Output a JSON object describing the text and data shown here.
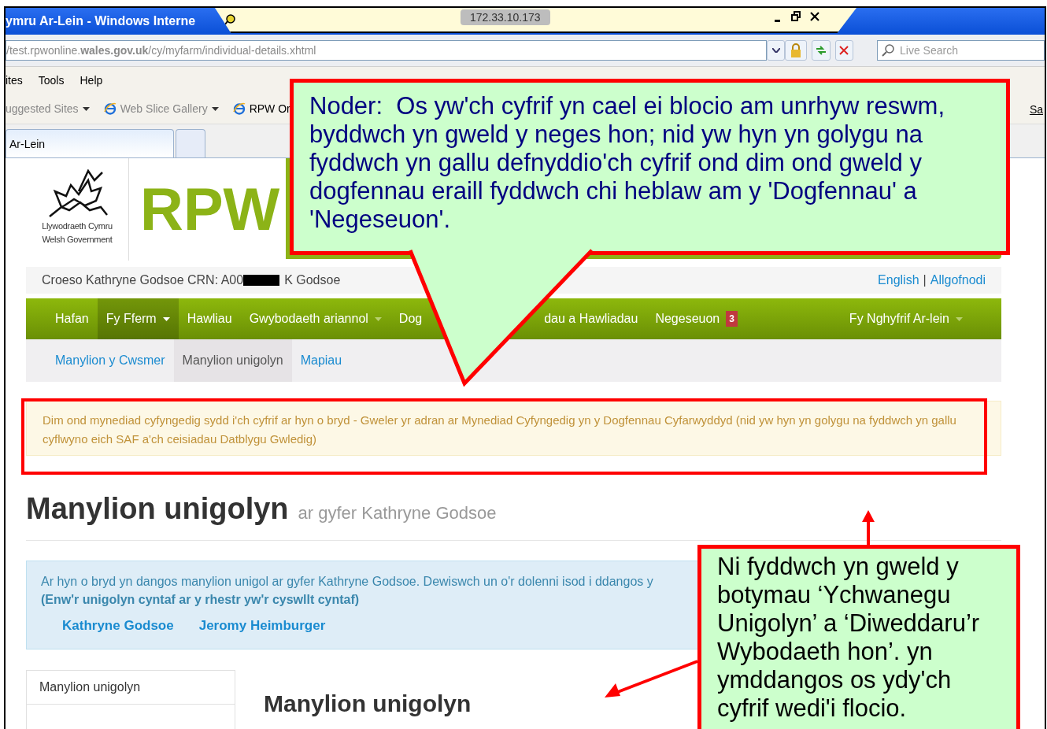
{
  "browser": {
    "title": "ymru Ar-Lein - Windows Interne",
    "ip": "172.33.10.173",
    "address": "/test.rpwonline.**wales.gov.uk**/cy/myfarm/individual-details.xhtml",
    "search_placeholder": "Live Search",
    "menu": [
      "ites",
      "Tools",
      "Help"
    ],
    "favorites": [
      {
        "label": "uggested Sites",
        "icon": false,
        "dropdown": true
      },
      {
        "label": "Web Slice Gallery",
        "icon": true,
        "dropdown": true
      },
      {
        "label": "RPW Or",
        "icon": true,
        "dropdown": false
      }
    ],
    "favorites_overflow": "Sa",
    "tabs": [
      {
        "label": "Ar-Lein",
        "selected": true
      }
    ]
  },
  "site": {
    "logo_lines": [
      "Llywodraeth Cymru",
      "Welsh Government"
    ],
    "brand": "RPW",
    "welcome": "Croeso Kathryne Godsoe CRN: A00",
    "welcome_suffix": "K Godsoe",
    "links": [
      "English",
      "Allgofnodi"
    ],
    "separator": "|",
    "nav": [
      {
        "label": "Hafan",
        "selected": false,
        "dropdown": false,
        "gap_after": false
      },
      {
        "label": "Fy Fferm",
        "selected": true,
        "dropdown": true,
        "gap_after": false
      },
      {
        "label": "Hawliau",
        "selected": false,
        "dropdown": false,
        "gap_after": false
      },
      {
        "label": "Gwybodaeth ariannol",
        "selected": false,
        "dropdown": true,
        "gap_after": false
      },
      {
        "label": "Dog",
        "selected": false,
        "dropdown": false,
        "gap_after": true
      },
      {
        "label": "dau a Hawliadau",
        "selected": false,
        "dropdown": false,
        "gap_after": false
      },
      {
        "label": "Negeseuon",
        "selected": false,
        "dropdown": false,
        "gap_after": false,
        "badge": "3"
      }
    ],
    "nav_right": {
      "label": "Fy Nghyfrif Ar-lein",
      "dropdown": true
    },
    "subnav": [
      {
        "label": "Manylion y Cwsmer",
        "selected": false
      },
      {
        "label": "Manylion unigolyn",
        "selected": true
      },
      {
        "label": "Mapiau",
        "selected": false
      }
    ],
    "notice": "Dim ond mynediad cyfyngedig sydd i'ch cyfrif ar hyn o bryd - Gweler yr adran ar Mynediad Cyfyngedig yn y Dogfennau Cyfarwyddyd (nid yw hyn yn golygu na fyddwch yn gallu cyflwyno eich SAF a'ch ceisiadau Datblygu Gwledig)",
    "heading": "Manylion unigolyn",
    "subheading": "ar gyfer Kathryne Godsoe",
    "info": {
      "text": "Ar hyn o bryd yn dangos manylion unigol ar gyfer Kathryne Godsoe. Dewiswch un o'r dolenni isod i ddangos y",
      "note": "(Enw'r unigolyn cyntaf ar y rhestr yw'r cyswllt cyntaf)",
      "people": [
        "Kathryne Godsoe",
        "Jeromy Heimburger"
      ]
    },
    "side_menu": [
      "Manylion unigolyn"
    ],
    "section_heading": "Manylion unigolyn"
  },
  "annotations": {
    "note_callout": "Noder:  Os yw'ch cyfrif yn cael ei blocio am unrhyw reswm, byddwch yn gweld y neges hon; nid yw hyn yn golygu na fyddwch yn gallu defnyddio'ch cyfrif ond dim ond gweld y dogfennau eraill fyddwch chi heblaw am y 'Dogfennau' a 'Negeseuon'.",
    "side_callout": "Ni fyddwch yn gweld y botymau ‘Ychwanegu Unigolyn’ a ‘Diweddaru’r Wybodaeth hon’. yn ymddangos os ydy'ch cyfrif wedi'i flocio."
  }
}
